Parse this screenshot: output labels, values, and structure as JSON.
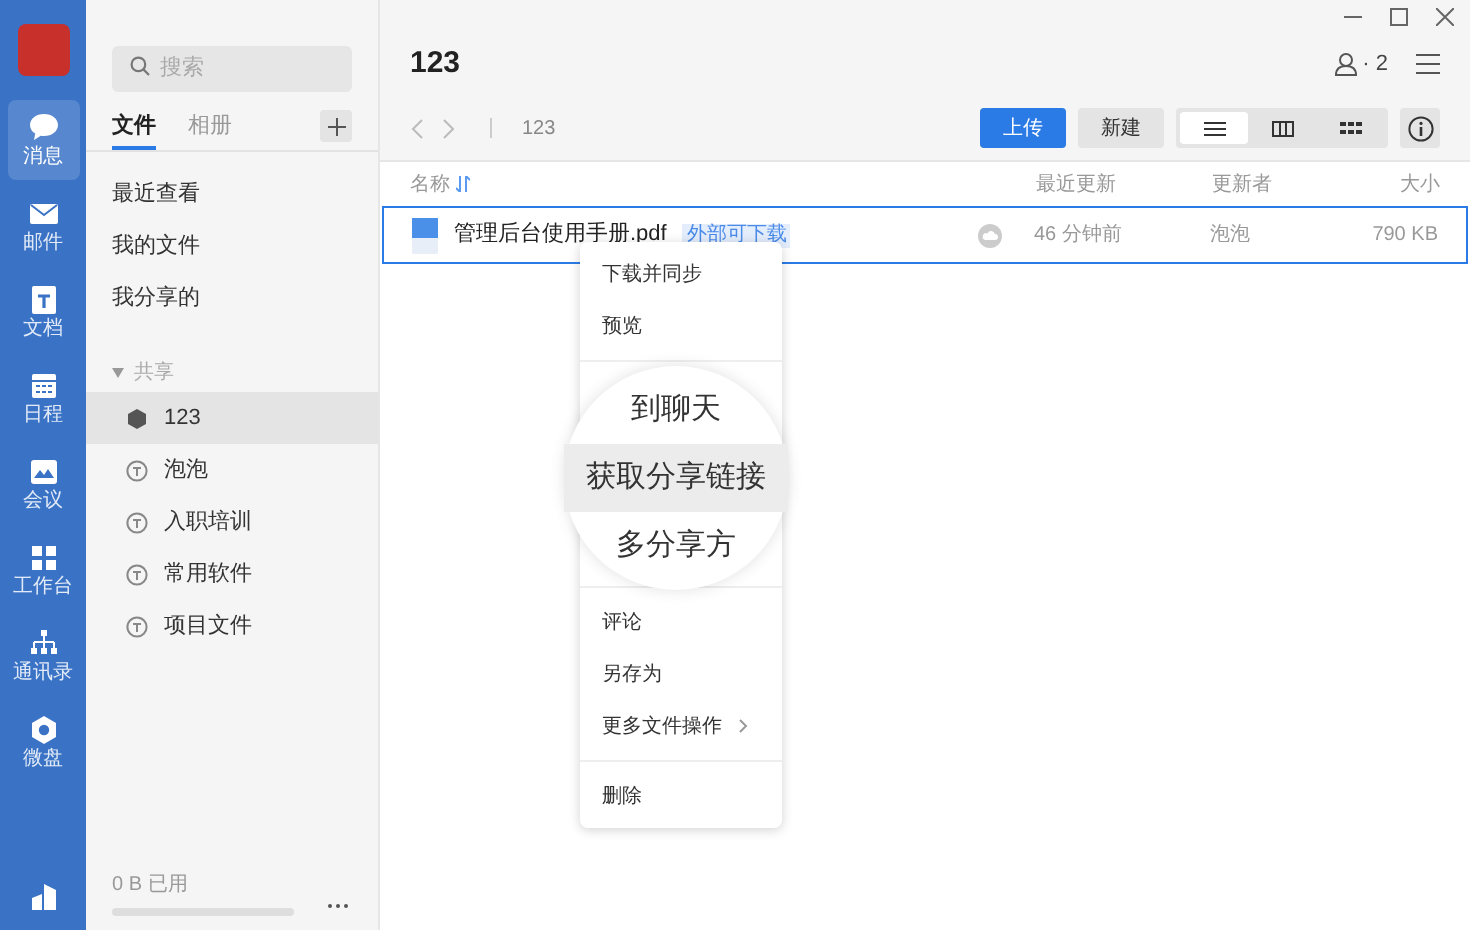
{
  "rail": {
    "items": [
      {
        "label": "消息",
        "selected": true
      },
      {
        "label": "邮件",
        "selected": false
      },
      {
        "label": "文档",
        "selected": false
      },
      {
        "label": "日程",
        "selected": false
      },
      {
        "label": "会议",
        "selected": false
      },
      {
        "label": "工作台",
        "selected": false
      },
      {
        "label": "通讯录",
        "selected": false
      },
      {
        "label": "微盘",
        "selected": false
      }
    ]
  },
  "sidebar": {
    "search": {
      "placeholder": "搜索"
    },
    "tabs": [
      {
        "label": "文件",
        "selected": true
      },
      {
        "label": "相册",
        "selected": false
      }
    ],
    "nav": [
      "最近查看",
      "我的文件",
      "我分享的"
    ],
    "section": {
      "label": "共享",
      "expanded": true,
      "items": [
        {
          "label": "123",
          "selected": true
        },
        {
          "label": "泡泡",
          "selected": false
        },
        {
          "label": "入职培训",
          "selected": false
        },
        {
          "label": "常用软件",
          "selected": false
        },
        {
          "label": "项目文件",
          "selected": false
        }
      ]
    },
    "storage": {
      "label": "0 B 已用"
    }
  },
  "main": {
    "title": "123",
    "members": "· 2",
    "breadcrumb": "123",
    "buttons": [
      {
        "label": "上传",
        "kind": "primary"
      },
      {
        "label": "新建",
        "kind": "secondary"
      }
    ],
    "views": [
      {
        "kind": "list",
        "selected": true
      },
      {
        "kind": "columns",
        "selected": false
      },
      {
        "kind": "grid",
        "selected": false
      }
    ],
    "table": {
      "columns": [
        "名称",
        "最近更新",
        "更新者",
        "大小"
      ],
      "rows": [
        {
          "name": "管理后台使用手册.pdf",
          "tag": "外部可下载",
          "updated": "46 分钟前",
          "updater": "泡泡",
          "size": "790 KB",
          "selected": true
        }
      ]
    }
  },
  "menu": {
    "groups": [
      {
        "kind": "items",
        "items": [
          {
            "label": "下载并同步",
            "submenu": false
          },
          {
            "label": "预览",
            "submenu": false
          }
        ]
      },
      {
        "kind": "magnified",
        "items": [
          {
            "label": "到聊天",
            "selected": false
          },
          {
            "label": "获取分享链接",
            "selected": true
          },
          {
            "label": "多分享方",
            "selected": false
          }
        ]
      },
      {
        "kind": "items",
        "items": [
          {
            "label": "评论",
            "submenu": false
          },
          {
            "label": "另存为",
            "submenu": false
          },
          {
            "label": "更多文件操作",
            "submenu": true
          }
        ]
      },
      {
        "kind": "items",
        "items": [
          {
            "label": "删除",
            "submenu": false
          }
        ]
      }
    ]
  }
}
